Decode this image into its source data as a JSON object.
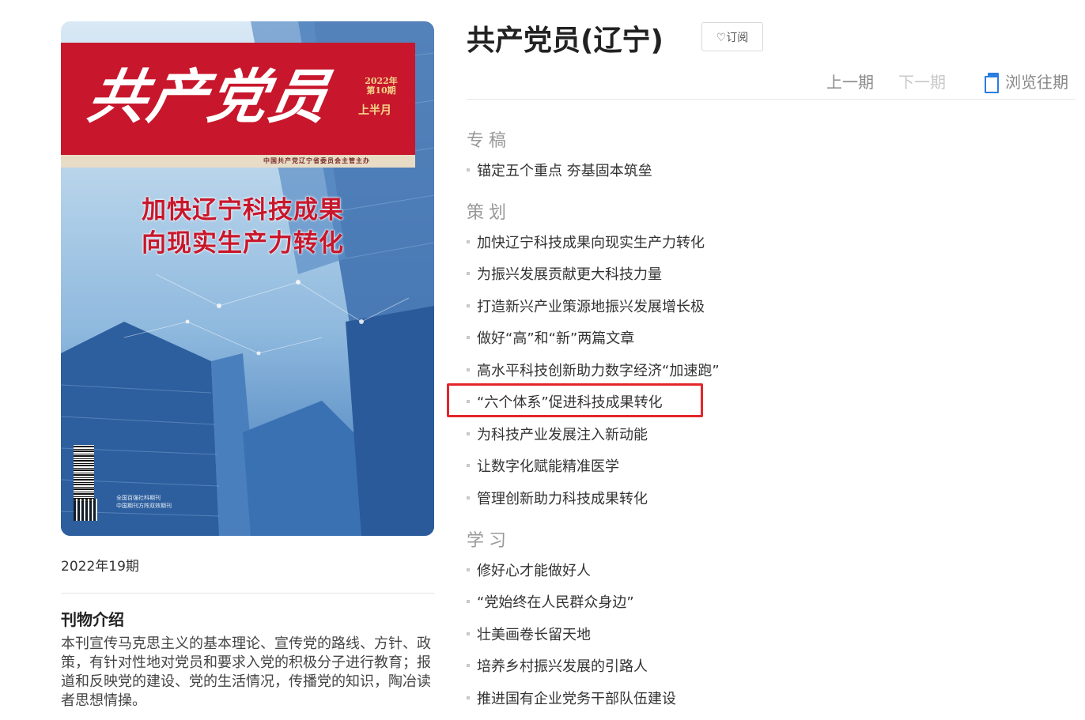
{
  "cover": {
    "masthead": "共产党员",
    "issue_year": "2022年",
    "issue_no": "第10期",
    "half_month": "上半月",
    "sponsor": "中国共产党辽宁省委员会主管主办",
    "headline_line1": "加快辽宁科技成果",
    "headline_line2": "向现实生产力转化",
    "small_line1": "全国百强社科期刊",
    "small_line2": "中国期刊方阵双效期刊"
  },
  "issue_label": "2022年19期",
  "intro": {
    "title": "刊物介绍",
    "text": "本刊宣传马克思主义的基本理论、宣传党的路线、方针、政策，有针对性地对党员和要求入党的积极分子进行教育；报道和反映党的建设、党的生活情况，传播党的知识，陶冶读者思想情操。"
  },
  "header": {
    "title": "共产党员(辽宁)",
    "subscribe_label": "♡订阅",
    "prev_label": "上一期",
    "next_label": "下一期",
    "browse_label": "浏览往期"
  },
  "toc": {
    "section1": "专稿",
    "section1_items": [
      "锚定五个重点 夯基固本筑垒"
    ],
    "section2": "策划",
    "section2_items": [
      "加快辽宁科技成果向现实生产力转化",
      "为振兴发展贡献更大科技力量",
      "打造新兴产业策源地振兴发展增长极",
      "做好“高”和“新”两篇文章",
      "高水平科技创新助力数字经济“加速跑”",
      "“六个体系”促进科技成果转化",
      "为科技产业发展注入新动能",
      "让数字化赋能精准医学",
      "管理创新助力科技成果转化"
    ],
    "section3": "学习",
    "section3_items": [
      "修好心才能做好人",
      "“党始终在人民群众身边”",
      "壮美画卷长留天地",
      "培养乡村振兴发展的引路人",
      "推进国有企业党务干部队伍建设"
    ]
  },
  "colors": {
    "highlight": "#e3262a",
    "accent": "#2a7de1",
    "cover_red": "#c8172c"
  },
  "icons": {
    "browse": "book-icon",
    "subscribe": "heart-icon"
  }
}
